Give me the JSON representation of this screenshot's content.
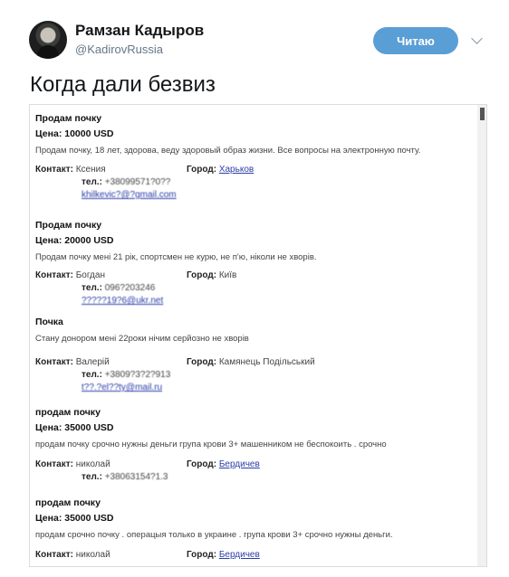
{
  "header": {
    "display_name": "Рамзан Кадыров",
    "handle": "@KadirovRussia",
    "follow_label": "Читаю"
  },
  "tweet": {
    "text": "Когда дали безвиз"
  },
  "ads": [
    {
      "title": "Продам почку",
      "price": "Цена: 10000 USD",
      "text": "Продам почку, 18 лет, здорова, веду здоровый образ жизни. Все вопросы на электронную почту.",
      "contact_label": "Контакт:",
      "contact": "Ксения",
      "city_label": "Город:",
      "city": "Харьков",
      "phone_label": "тел.:",
      "phone": "+38099571?0??",
      "email": "khilkevic?@?gmail.com"
    },
    {
      "title": "Продам почку",
      "price": "Цена: 20000 USD",
      "text": "Продам почку мені 21 рік, спортсмен не курю, не п'ю, ніколи не хворів.",
      "contact_label": "Контакт:",
      "contact": "Богдан",
      "city_label": "Город:",
      "city": "Київ",
      "phone_label": "тел.:",
      "phone": "096?203246",
      "email": "?????19?6@ukr.net"
    },
    {
      "title": "Почка",
      "price": "",
      "text": "Стану донором мені 22роки нічим серйозно не хворів",
      "contact_label": "Контакт:",
      "contact": "Валерій",
      "city_label": "Город:",
      "city": "Камянець Подільський",
      "phone_label": "тел.:",
      "phone": "+3809?3?2?913",
      "email": "t??.?el??ty@mail.ru"
    },
    {
      "title": "продам почку",
      "price": "Цена: 35000 USD",
      "text": "продам почку срочно нужны деньги група крови 3+ машенником не беспокоить . срочно",
      "contact_label": "Контакт:",
      "contact": "николай",
      "city_label": "Город:",
      "city": "Бердичев",
      "phone_label": "тел.:",
      "phone": "+38063154?1.3",
      "email": ""
    },
    {
      "title": "продам почку",
      "price": "Цена: 35000 USD",
      "text": "продам срочно почку . операцыя только в украине . група крови 3+ срочно нужны деньги.",
      "contact_label": "Контакт:",
      "contact": "николай",
      "city_label": "Город:",
      "city": "Бердичев",
      "phone_label": "",
      "phone": "",
      "email": ""
    }
  ]
}
